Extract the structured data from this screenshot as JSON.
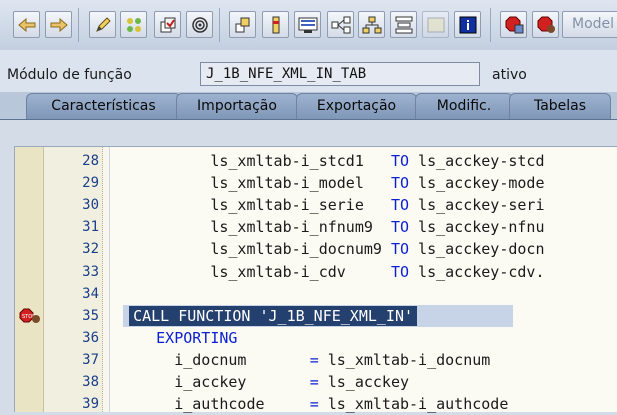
{
  "toolbar": {
    "model_label": "Model",
    "icons": [
      "back-icon",
      "forward-icon",
      "edit-icon",
      "other-object-icon",
      "check-icon",
      "activate-icon",
      "where-used-icon",
      "insert-icon",
      "display-object-list-icon",
      "navigate-icon",
      "hierarchy-icon",
      "pattern-icon",
      "frame-icon",
      "info-icon",
      "breakpoint-icon",
      "session-breakpoint-icon"
    ]
  },
  "field": {
    "label": "Módulo de função",
    "value": "J_1B_NFE_XML_IN_TAB",
    "status": "ativo"
  },
  "tabs": [
    {
      "label": "Características"
    },
    {
      "label": "Importação"
    },
    {
      "label": "Exportação"
    },
    {
      "label": "Modific."
    },
    {
      "label": "Tabelas"
    }
  ],
  "lines": [
    {
      "num": "28",
      "pre": "           ls_xmltab-i_stcd1   ",
      "kw": "TO",
      "post": " ls_acckey-stcd"
    },
    {
      "num": "29",
      "pre": "           ls_xmltab-i_model   ",
      "kw": "TO",
      "post": " ls_acckey-mode"
    },
    {
      "num": "30",
      "pre": "           ls_xmltab-i_serie   ",
      "kw": "TO",
      "post": " ls_acckey-seri"
    },
    {
      "num": "31",
      "pre": "           ls_xmltab-i_nfnum9  ",
      "kw": "TO",
      "post": " ls_acckey-nfnu"
    },
    {
      "num": "32",
      "pre": "           ls_xmltab-i_docnum9 ",
      "kw": "TO",
      "post": " ls_acckey-docn"
    },
    {
      "num": "33",
      "pre": "           ls_xmltab-i_cdv     ",
      "kw": "TO",
      "post": " ls_acckey-cdv."
    },
    {
      "num": "34",
      "pre": "",
      "kw": "",
      "post": ""
    },
    {
      "num": "35",
      "pre": "  ",
      "hl": "CALL FUNCTION 'J_1B_NFE_XML_IN'",
      "kw": "",
      "post": ""
    },
    {
      "num": "36",
      "pre": "     ",
      "kw": "EXPORTING",
      "post": ""
    },
    {
      "num": "37",
      "pre": "       i_docnum       ",
      "kw": "=",
      "post": " ls_xmltab-i_docnum"
    },
    {
      "num": "38",
      "pre": "       i_acckey       ",
      "kw": "=",
      "post": " ls_acckey"
    },
    {
      "num": "39",
      "pre": "       i_authcode     ",
      "kw": "=",
      "post": " ls_xmltab-i_authcode"
    }
  ]
}
